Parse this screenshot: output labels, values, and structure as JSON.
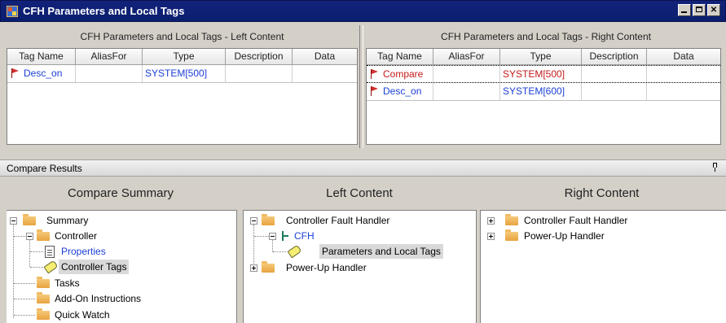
{
  "window": {
    "title": "CFH Parameters and Local Tags"
  },
  "left_pane": {
    "header": "CFH Parameters and Local Tags - Left Content",
    "columns": [
      "Tag Name",
      "AliasFor",
      "Type",
      "Description",
      "Data"
    ],
    "rows": [
      {
        "tag_name": "Desc_on",
        "alias_for": "",
        "type": "SYSTEM[500]",
        "description": "",
        "data": ""
      }
    ]
  },
  "right_pane": {
    "header": "CFH Parameters and Local Tags - Right Content",
    "columns": [
      "Tag Name",
      "AliasFor",
      "Type",
      "Description",
      "Data"
    ],
    "rows": [
      {
        "tag_name": "Compare",
        "alias_for": "",
        "type": "SYSTEM[500]",
        "description": "",
        "data": ""
      },
      {
        "tag_name": "Desc_on",
        "alias_for": "",
        "type": "SYSTEM[600]",
        "description": "",
        "data": ""
      }
    ]
  },
  "results": {
    "title": "Compare Results",
    "summary_header": "Compare Summary",
    "left_header": "Left Content",
    "right_header": "Right Content",
    "summary_tree": {
      "summary": "Summary",
      "controller": "Controller",
      "properties": "Properties",
      "controller_tags": "Controller Tags",
      "tasks": "Tasks",
      "add_on": "Add-On Instructions",
      "quick_watch": "Quick Watch"
    },
    "left_tree": {
      "cfh": "Controller Fault Handler",
      "cfh_routine": "CFH",
      "params": "Parameters and Local Tags",
      "power_up": "Power-Up Handler"
    },
    "right_tree": {
      "cfh": "Controller Fault Handler",
      "power_up": "Power-Up Handler"
    }
  },
  "colors": {
    "title_bar": "#12227a",
    "link_blue": "#1b3fd6",
    "diff_red": "#c41a1a",
    "folder": "#e7a33f"
  }
}
